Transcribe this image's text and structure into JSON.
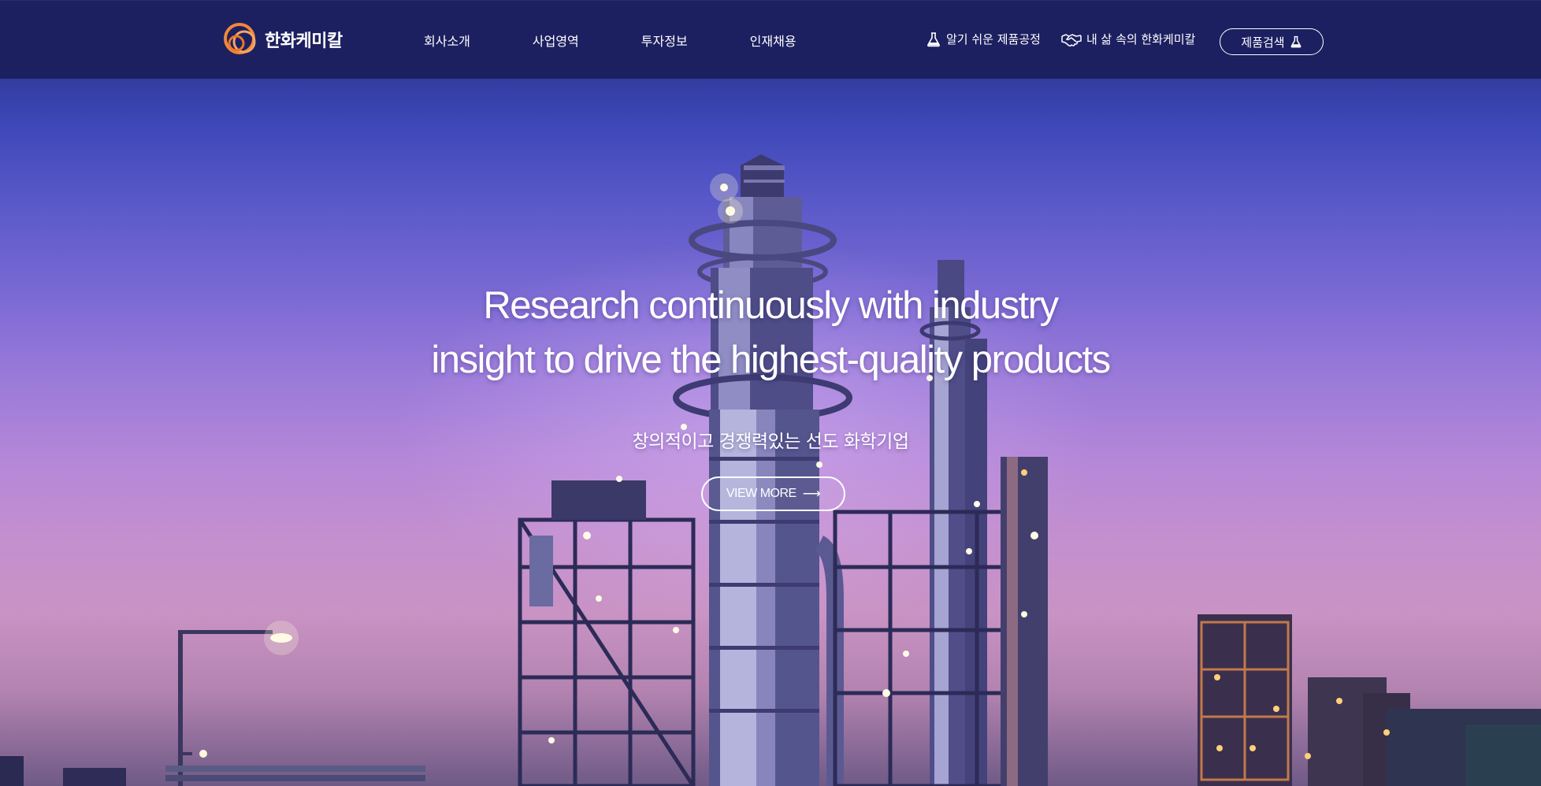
{
  "header": {
    "logo_text": "한화케미칼",
    "nav": [
      "회사소개",
      "사업영역",
      "투자정보",
      "인재채용"
    ],
    "util_links": [
      {
        "label": "알기 쉬운 제품공정",
        "icon": "flask-icon"
      },
      {
        "label": "내 삶 속의 한화케미칼",
        "icon": "handshake-icon"
      }
    ],
    "search_button": {
      "label": "제품검색",
      "icon": "flask-icon"
    }
  },
  "hero": {
    "headline_line1": "Research continuously with industry",
    "headline_line2": "insight to drive the highest-quality products",
    "subline": "창의적이고 경쟁력있는 선도 화학기업",
    "cta_label": "VIEW MORE",
    "cta_arrow": "⟶"
  },
  "colors": {
    "header_bg": "#1c2060",
    "sky_top": "#2e3898",
    "sky_bottom": "#c993c4",
    "logo_orange": "#f0883a",
    "text": "#ffffff"
  }
}
